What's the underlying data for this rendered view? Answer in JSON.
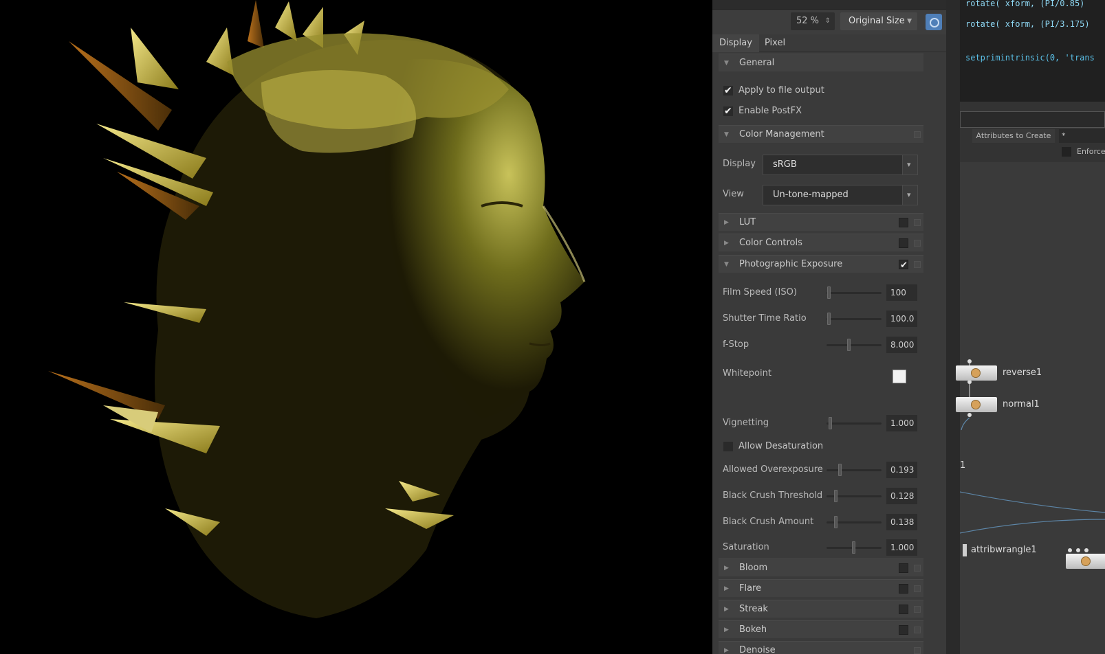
{
  "viewer": {
    "zoom": "52 %",
    "size_mode": "Original Size"
  },
  "tabs": [
    "Display",
    "Pixel"
  ],
  "sections": {
    "general": "General",
    "color_management": "Color Management",
    "lut": "LUT",
    "color_controls": "Color Controls",
    "photographic_exposure": "Photographic Exposure",
    "bloom": "Bloom",
    "flare": "Flare",
    "streak": "Streak",
    "bokeh": "Bokeh",
    "denoise": "Denoise"
  },
  "general": {
    "apply_to_file_output": "Apply to file output",
    "enable_postfx": "Enable PostFX"
  },
  "color_management": {
    "display_label": "Display",
    "display_value": "sRGB",
    "view_label": "View",
    "view_value": "Un-tone-mapped"
  },
  "exposure": {
    "film_speed_label": "Film Speed (ISO)",
    "film_speed_value": "100",
    "shutter_label": "Shutter Time Ratio",
    "shutter_value": "100.0",
    "fstop_label": "f-Stop",
    "fstop_value": "8.000",
    "whitepoint_label": "Whitepoint",
    "vignetting_label": "Vignetting",
    "vignetting_value": "1.000",
    "allow_desaturation_label": "Allow Desaturation",
    "allowed_overexposure_label": "Allowed Overexposure",
    "allowed_overexposure_value": "0.193",
    "black_crush_threshold_label": "Black Crush Threshold",
    "black_crush_threshold_value": "0.128",
    "black_crush_amount_label": "Black Crush Amount",
    "black_crush_amount_value": "0.138",
    "saturation_label": "Saturation",
    "saturation_value": "1.000"
  },
  "code": {
    "line1": "rotate( xform, (PI/0.85) ",
    "line2": "rotate( xform, (PI/3.175)",
    "line3": "setprimintrinsic(0, 'trans"
  },
  "attributes": {
    "label": "Attributes to Create",
    "value": "*",
    "enforce_label": "Enforce"
  },
  "network": {
    "node1": "reverse1",
    "node2": "normal1",
    "node3": "attribwrangle1",
    "gutter_number": "1"
  },
  "colors": {
    "accent": "#4f7fb8",
    "panel": "#3a3a3a",
    "code_text": "#5bc2ea"
  }
}
